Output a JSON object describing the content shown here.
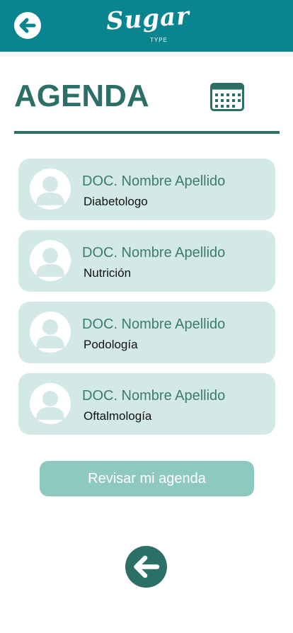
{
  "header": {
    "logo_text": "Sugar",
    "logo_subtext": "TYPE",
    "back_icon": "arrow-left-icon",
    "background_color": "#0a858f"
  },
  "page": {
    "title": "AGENDA",
    "calendar_icon": "calendar-icon",
    "accent_color": "#2b6f67"
  },
  "doctors": [
    {
      "name": "DOC. Nombre Apellido",
      "specialty": "Diabetologo",
      "avatar_icon": "user-avatar-icon"
    },
    {
      "name": "DOC. Nombre Apellido",
      "specialty": "Nutrición",
      "avatar_icon": "user-avatar-icon"
    },
    {
      "name": "DOC. Nombre Apellido",
      "specialty": "Podología",
      "avatar_icon": "user-avatar-icon"
    },
    {
      "name": "DOC. Nombre Apellido",
      "specialty": "Oftalmología",
      "avatar_icon": "user-avatar-icon"
    }
  ],
  "actions": {
    "review_label": "Revisar mi agenda",
    "review_color": "#8ec9c0"
  },
  "footer": {
    "back_icon": "arrow-left-icon"
  }
}
